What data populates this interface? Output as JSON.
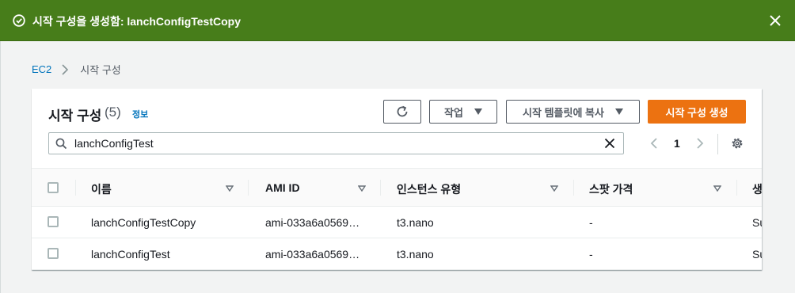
{
  "flash": {
    "message": "시작 구성을 생성함: lanchConfigTestCopy",
    "status_color": "#477d1a"
  },
  "breadcrumb": {
    "root": "EC2",
    "current": "시작 구성"
  },
  "panel": {
    "title": "시작 구성",
    "count": "(5)",
    "info_link": "정보"
  },
  "toolbar": {
    "refresh_icon": "refresh-icon",
    "actions_label": "작업",
    "copy_to_template_label": "시작 템플릿에 복사",
    "create_label": "시작 구성 생성",
    "primary_color": "#ec7211"
  },
  "search": {
    "value": "lanchConfigTest",
    "placeholder": ""
  },
  "pagination": {
    "current_page": "1"
  },
  "table": {
    "columns": [
      "이름",
      "AMI ID",
      "인스턴스 유형",
      "스팟 가격",
      "생"
    ],
    "rows": [
      {
        "name": "lanchConfigTestCopy",
        "ami": "ami-033a6a0569…",
        "type": "t3.nano",
        "spot": "-",
        "created": "Su"
      },
      {
        "name": "lanchConfigTest",
        "ami": "ami-033a6a0569…",
        "type": "t3.nano",
        "spot": "-",
        "created": "Su"
      }
    ]
  }
}
